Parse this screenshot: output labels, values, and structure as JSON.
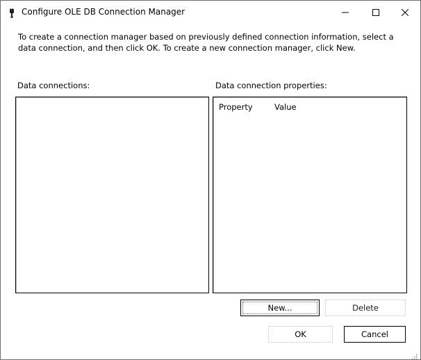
{
  "window": {
    "title": "Configure OLE DB Connection Manager",
    "icon": "connection-plug-icon"
  },
  "title_buttons": {
    "minimize": "minimize-icon",
    "maximize": "maximize-icon",
    "close": "close-icon"
  },
  "instructions": "To create a connection manager based on previously defined connection information, select a data connection, and then click OK. To create a new connection manager, click New.",
  "data_connections": {
    "label": "Data connections:",
    "items": []
  },
  "data_connection_properties": {
    "label": "Data connection properties:",
    "columns": [
      "Property",
      "Value"
    ],
    "rows": []
  },
  "buttons": {
    "new": "New...",
    "delete": "Delete",
    "ok": "OK",
    "cancel": "Cancel"
  }
}
